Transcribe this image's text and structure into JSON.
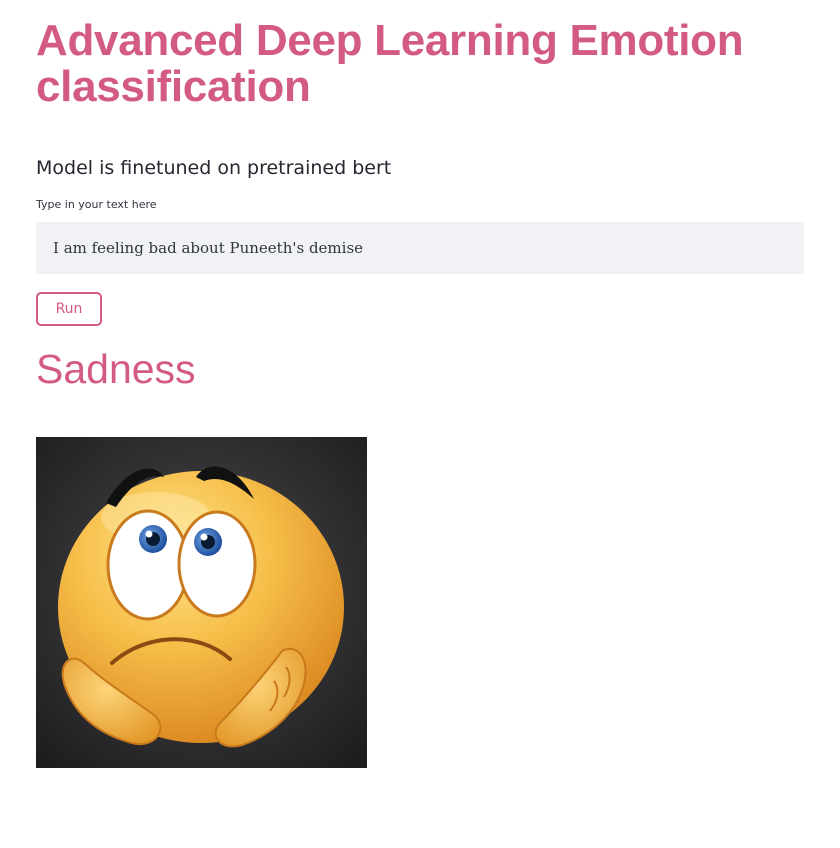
{
  "page": {
    "title": "Advanced Deep Learning Emotion classification",
    "subtitle": "Model is finetuned on pretrained bert"
  },
  "form": {
    "input_label": "Type in your text here",
    "input_value": "I am feeling bad about Puneeth's demise",
    "run_label": "Run"
  },
  "result": {
    "emotion": "Sadness",
    "image_icon": "sad-face-emoji-icon"
  },
  "colors": {
    "accent": "#d35b83",
    "input_background": "#f0f2f6",
    "text": "#262730",
    "image_background": "#2b2b2d",
    "emoji_face": "#f2a93b"
  }
}
